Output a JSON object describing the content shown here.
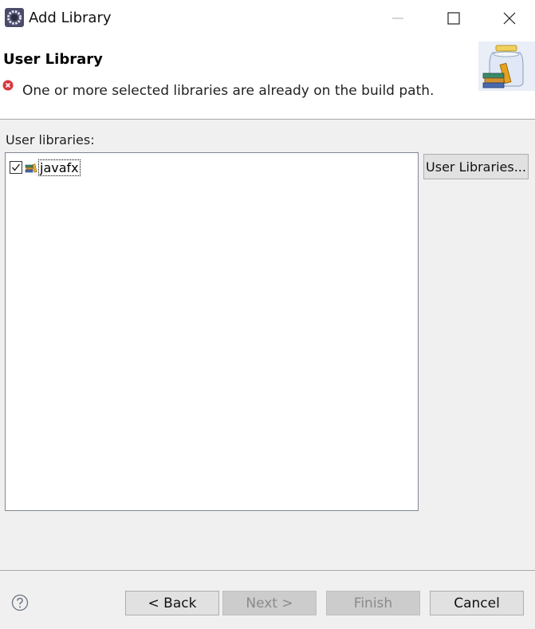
{
  "window": {
    "title": "Add Library",
    "app_icon": "eclipse-gear-icon",
    "controls": [
      "minimize-icon",
      "maximize-icon",
      "close-icon"
    ]
  },
  "banner": {
    "page_title": "User Library",
    "message": "One or more selected libraries are already on the build path.",
    "message_icon": "error-icon",
    "image": "library-jar-books-icon"
  },
  "body": {
    "list_label": "User libraries:",
    "items": [
      {
        "label": "javafx",
        "checked": true,
        "icon": "library-icon"
      }
    ],
    "user_libraries_button": "User Libraries..."
  },
  "footer": {
    "help_icon": "help-icon",
    "back_label": "< Back",
    "next_label": "Next >",
    "finish_label": "Finish",
    "cancel_label": "Cancel",
    "next_enabled": false,
    "finish_enabled": false
  },
  "colors": {
    "dialog_bg": "#f0f0f0",
    "banner_bg": "#ffffff",
    "error_red": "#d9363e",
    "button_bg": "#e1e1e1"
  }
}
